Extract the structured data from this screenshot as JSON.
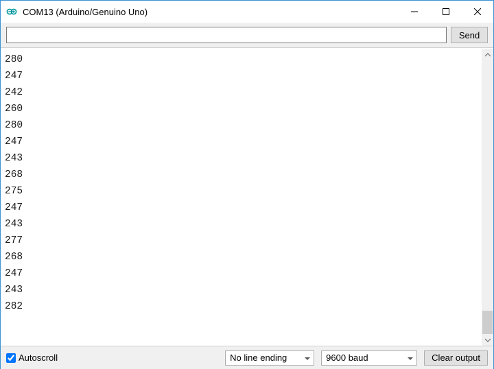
{
  "window": {
    "title": "COM13 (Arduino/Genuino Uno)"
  },
  "toolbar": {
    "send_label": "Send"
  },
  "output": {
    "lines": [
      "280",
      "247",
      "242",
      "260",
      "280",
      "247",
      "243",
      "268",
      "275",
      "247",
      "243",
      "277",
      "268",
      "247",
      "243",
      "282"
    ]
  },
  "footer": {
    "autoscroll_label": "Autoscroll",
    "autoscroll_checked": true,
    "line_ending_value": "No line ending",
    "baud_value": "9600 baud",
    "clear_label": "Clear output"
  }
}
